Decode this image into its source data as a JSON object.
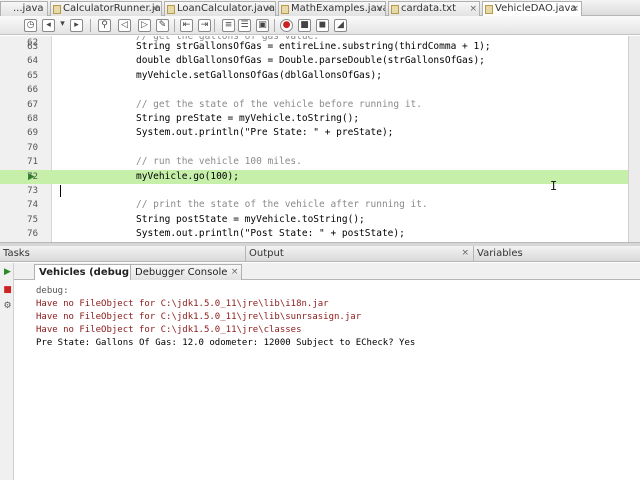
{
  "tabs": [
    {
      "label": "...java",
      "active": false
    },
    {
      "label": "CalculatorRunner.java",
      "active": false
    },
    {
      "label": "LoanCalculator.java",
      "active": false
    },
    {
      "label": "MathExamples.java",
      "active": false
    },
    {
      "label": "cardata.txt",
      "active": false
    },
    {
      "label": "VehicleDAO.java",
      "active": true
    }
  ],
  "tab_close_glyph": "×",
  "toolbar": {
    "icons": [
      "history-icon",
      "back-icon",
      "dropdown-icon",
      "search-icon",
      "find-prev-icon",
      "find-next-icon",
      "toggle-highlight-icon",
      "shift-left-icon",
      "shift-right-icon",
      "comment-icon",
      "uncomment-icon",
      "record-macro-icon",
      "stop-macro-icon",
      "toggle-bookmark-icon"
    ]
  },
  "editor": {
    "lines": [
      {
        "num": "62",
        "text": "// get the gallons of gas value:",
        "kind": "comment",
        "highlight": false
      },
      {
        "num": "63",
        "text": "String strGallonsOfGas = entireLine.substring(thirdComma + 1);",
        "kind": "code",
        "highlight": false
      },
      {
        "num": "64",
        "text": "double dblGallonsOfGas = Double.parseDouble(strGallonsOfGas);",
        "kind": "code",
        "highlight": false
      },
      {
        "num": "65",
        "text": "myVehicle.setGallonsOfGas(dblGallonsOfGas);",
        "kind": "code",
        "highlight": false
      },
      {
        "num": "66",
        "text": "",
        "kind": "code",
        "highlight": false
      },
      {
        "num": "67",
        "text": "// get the state of the vehicle before running it.",
        "kind": "comment",
        "highlight": false
      },
      {
        "num": "68",
        "text": "String preState = myVehicle.toString();",
        "kind": "code",
        "highlight": false
      },
      {
        "num": "69",
        "text": "System.out.println(\"Pre State: \" + preState);",
        "kind": "code",
        "highlight": false
      },
      {
        "num": "70",
        "text": "",
        "kind": "code",
        "highlight": false
      },
      {
        "num": "71",
        "text": "// run the vehicle 100 miles.",
        "kind": "comment",
        "highlight": false
      },
      {
        "num": "72",
        "text": "myVehicle.go(100);",
        "kind": "code",
        "highlight": true
      },
      {
        "num": "73",
        "text": "",
        "kind": "code",
        "highlight": false
      },
      {
        "num": "74",
        "text": "// print the state of the vehicle after running it.",
        "kind": "comment",
        "highlight": false
      },
      {
        "num": "75",
        "text": "String postState = myVehicle.toString();",
        "kind": "code",
        "highlight": false
      },
      {
        "num": "76",
        "text": "System.out.println(\"Post State: \" + postState);",
        "kind": "code",
        "highlight": false
      }
    ],
    "pc_marker": "▶"
  },
  "panels": {
    "tasks": "Tasks",
    "output": "Output",
    "variables": "Variables",
    "close_glyph": "×"
  },
  "output_tabs": [
    {
      "label": "Vehicles (debug)",
      "active": true
    },
    {
      "label": "Debugger Console",
      "active": false
    }
  ],
  "output_lines": [
    {
      "text": "debug:",
      "kind": "debug"
    },
    {
      "text": "Have no FileObject for C:\\jdk1.5.0_11\\jre\\lib\\i18n.jar",
      "kind": "err"
    },
    {
      "text": "Have no FileObject for C:\\jdk1.5.0_11\\jre\\lib\\sunrsasign.jar",
      "kind": "err"
    },
    {
      "text": "Have no FileObject for C:\\jdk1.5.0_11\\jre\\classes",
      "kind": "err"
    },
    {
      "text": "Pre State: Gallons Of Gas: 12.0 odometer: 12000 Subject to ECheck? Yes",
      "kind": "normal"
    }
  ],
  "output_side_icons": [
    "rerun-icon",
    "stop-icon",
    "gear-icon"
  ],
  "colors": {
    "highlight_line": "#c6f0a9",
    "error_text": "#8b1a1a",
    "comment_text": "#8a8a8a"
  }
}
